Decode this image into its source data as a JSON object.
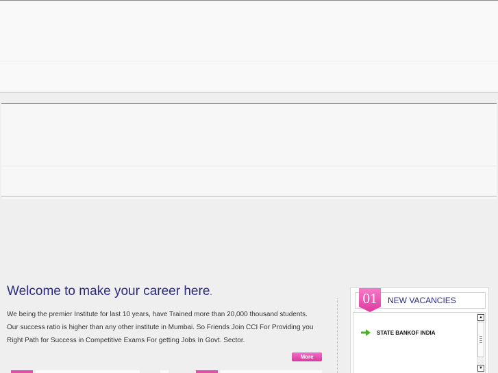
{
  "welcome": {
    "heading": "Welcome to make your career here",
    "heading_dot": ".",
    "text": "We being the premier Institute for last 10 years, have Trained more than 20,000 thousand students. Our success ratio is higher than any other institute in Mumbai. So Friends Join CCI For Providing you Right Path for Success in Competitive Exams For getting Jobs In Govt. Sector.",
    "more_label": "More"
  },
  "vacancies": {
    "number": "01",
    "title": "NEW VACANCIES",
    "items": [
      {
        "icon": "green-arrow-icon",
        "label": "STATE BANKOF INDIA"
      }
    ]
  },
  "colors": {
    "accent_pink": "#e24fa9",
    "heading_blue": "#2b2a7d",
    "arrow_green": "#4caf2e"
  }
}
